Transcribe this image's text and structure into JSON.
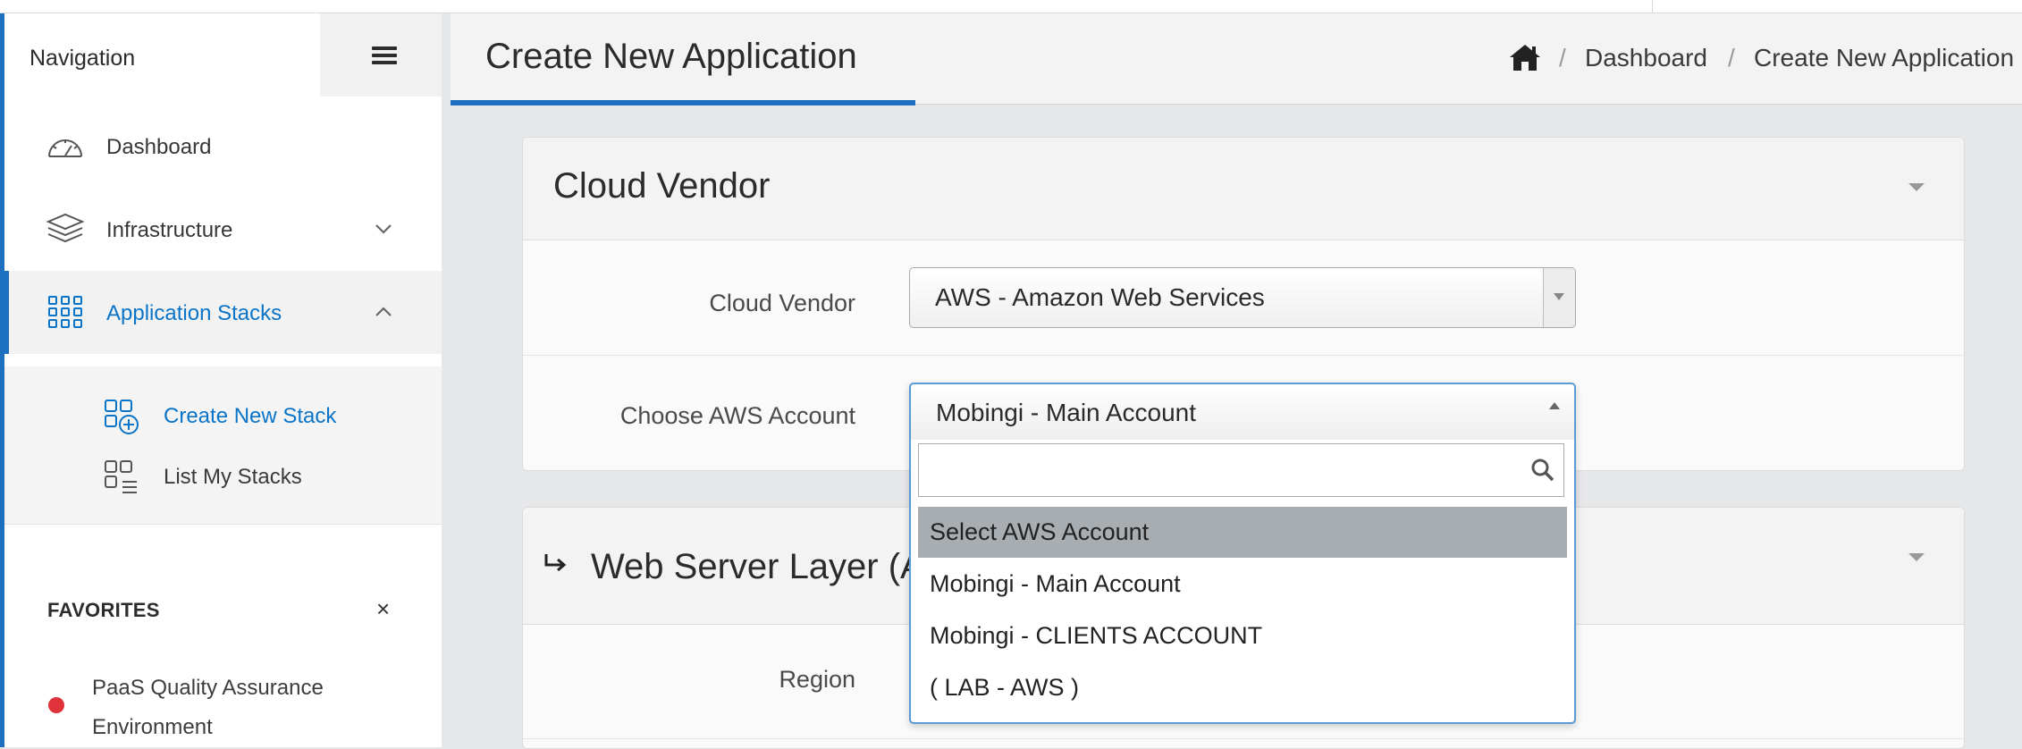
{
  "sidebar": {
    "title": "Navigation",
    "items": [
      {
        "label": "Dashboard"
      },
      {
        "label": "Infrastructure"
      },
      {
        "label": "Application Stacks"
      }
    ],
    "subitems": [
      {
        "label": "Create New Stack"
      },
      {
        "label": "List My Stacks"
      }
    ],
    "favorites": {
      "title": "FAVORITES",
      "close": "×",
      "item": "PaaS Quality Assurance Environment",
      "status_color": "#e0323a"
    }
  },
  "header": {
    "title": "Create New Application",
    "breadcrumb": [
      "Dashboard",
      "Create New Application"
    ],
    "separator": "/"
  },
  "cloud_vendor_card": {
    "title": "Cloud Vendor",
    "vendor_label": "Cloud Vendor",
    "vendor_value": "AWS - Amazon Web Services",
    "account_label": "Choose AWS Account",
    "account_value": "Mobingi - Main Account"
  },
  "account_dropdown": {
    "search_value": "",
    "options": [
      "Select AWS Account",
      "Mobingi - Main Account",
      "Mobingi - CLIENTS ACCOUNT",
      "( LAB - AWS )"
    ],
    "highlighted_index": 0
  },
  "web_server_card": {
    "title": "Web Server Layer (An",
    "region_label": "Region"
  },
  "colors": {
    "accent": "#1d6fc0",
    "active_text": "#0a74c8",
    "highlight": "#a8adb2"
  }
}
